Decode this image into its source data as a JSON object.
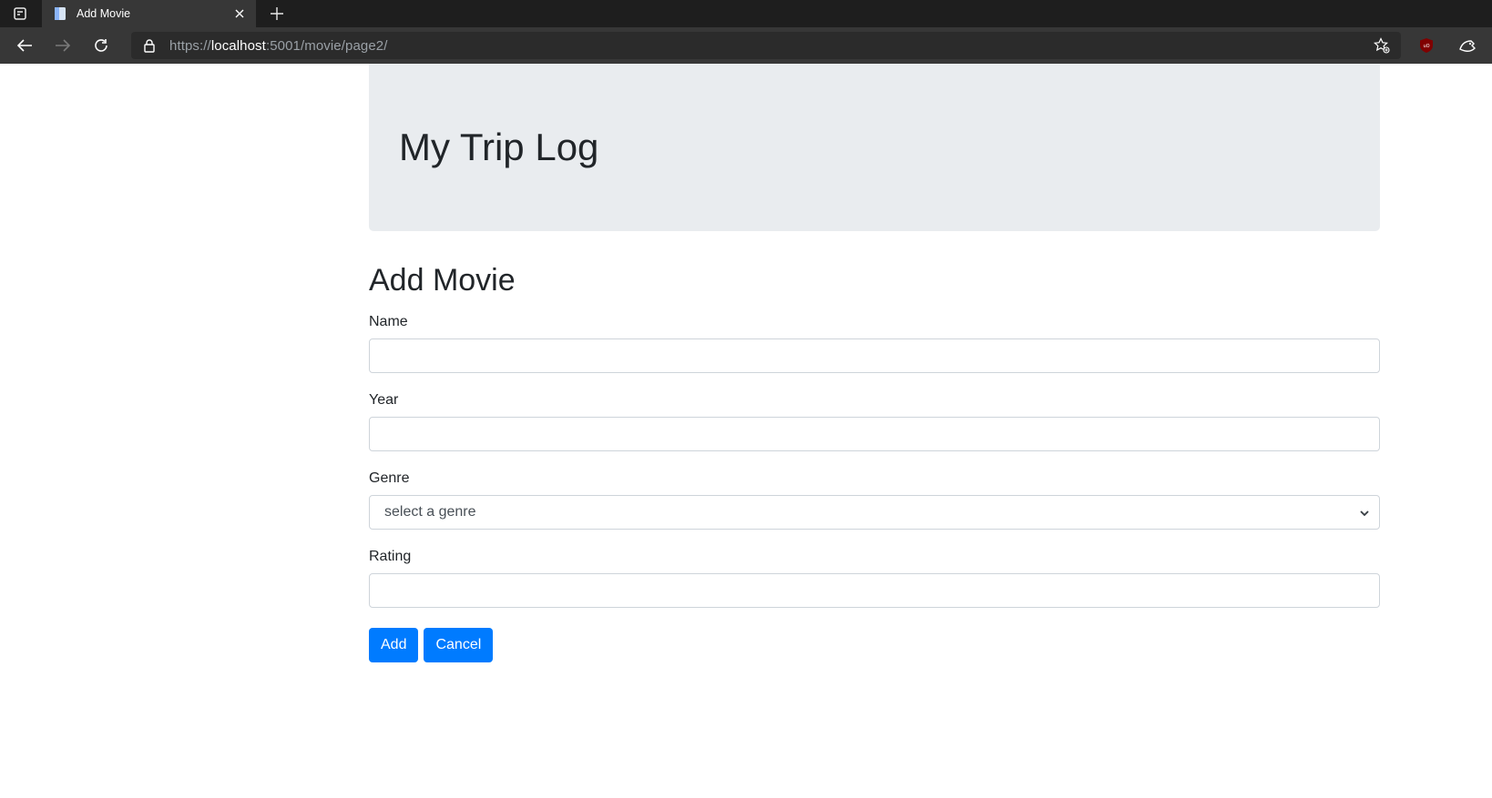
{
  "browser": {
    "tab_title": "Add Movie",
    "url_scheme": "https://",
    "url_host": "localhost",
    "url_rest": ":5001/movie/page2/"
  },
  "header": {
    "title": "My Trip Log"
  },
  "main": {
    "heading": "Add Movie",
    "fields": {
      "name": {
        "label": "Name",
        "value": ""
      },
      "year": {
        "label": "Year",
        "value": ""
      },
      "genre": {
        "label": "Genre",
        "selected": "select a genre"
      },
      "rating": {
        "label": "Rating",
        "value": ""
      }
    },
    "buttons": {
      "add": "Add",
      "cancel": "Cancel"
    }
  },
  "colors": {
    "primary": "#007bff",
    "jumbotron_bg": "#e9ecef",
    "text": "#212529"
  }
}
